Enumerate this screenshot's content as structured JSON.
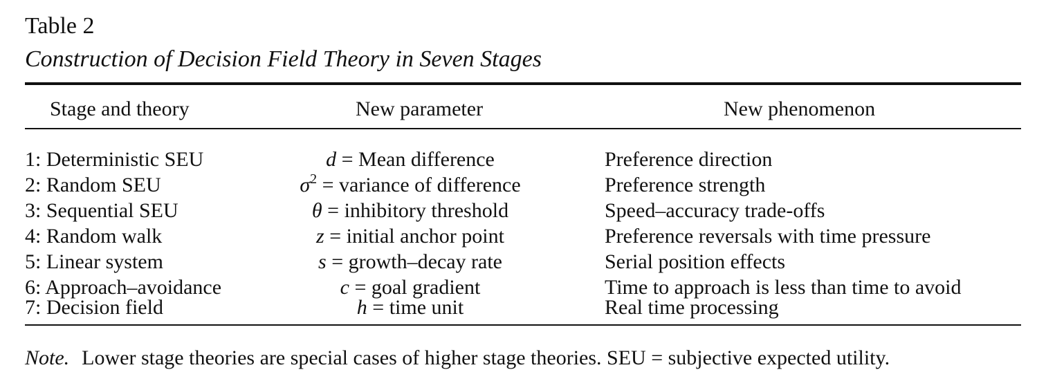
{
  "table": {
    "label": "Table 2",
    "title": "Construction of Decision Field Theory in Seven Stages",
    "headers": {
      "stage": "Stage and theory",
      "parameter": "New parameter",
      "phenomenon": "New phenomenon"
    },
    "rows": [
      {
        "stage": "1: Deterministic SEU",
        "symbol": "d",
        "superscript": "",
        "definition": " = Mean difference",
        "phenomenon": "Preference direction"
      },
      {
        "stage": "2: Random SEU",
        "symbol": "σ",
        "superscript": "2",
        "definition": " = variance of difference",
        "phenomenon": "Preference strength"
      },
      {
        "stage": "3: Sequential SEU",
        "symbol": "θ",
        "superscript": "",
        "definition": " = inhibitory threshold",
        "phenomenon": "Speed–accuracy trade-offs"
      },
      {
        "stage": "4: Random walk",
        "symbol": "z",
        "superscript": "",
        "definition": " = initial anchor point",
        "phenomenon": "Preference reversals with time pressure"
      },
      {
        "stage": "5: Linear system",
        "symbol": "s",
        "superscript": "",
        "definition": " = growth–decay rate",
        "phenomenon": "Serial position effects"
      },
      {
        "stage": "6: Approach–avoidance",
        "symbol": "c",
        "superscript": "",
        "definition": " = goal gradient",
        "phenomenon": "Time to approach is less than time to avoid"
      },
      {
        "stage": "7: Decision field",
        "symbol": "h",
        "superscript": "",
        "definition": " = time unit",
        "phenomenon": "Real time processing"
      }
    ],
    "note": {
      "label": "Note.",
      "text": "Lower stage theories are special cases of higher stage theories. SEU = subjective expected utility."
    }
  }
}
